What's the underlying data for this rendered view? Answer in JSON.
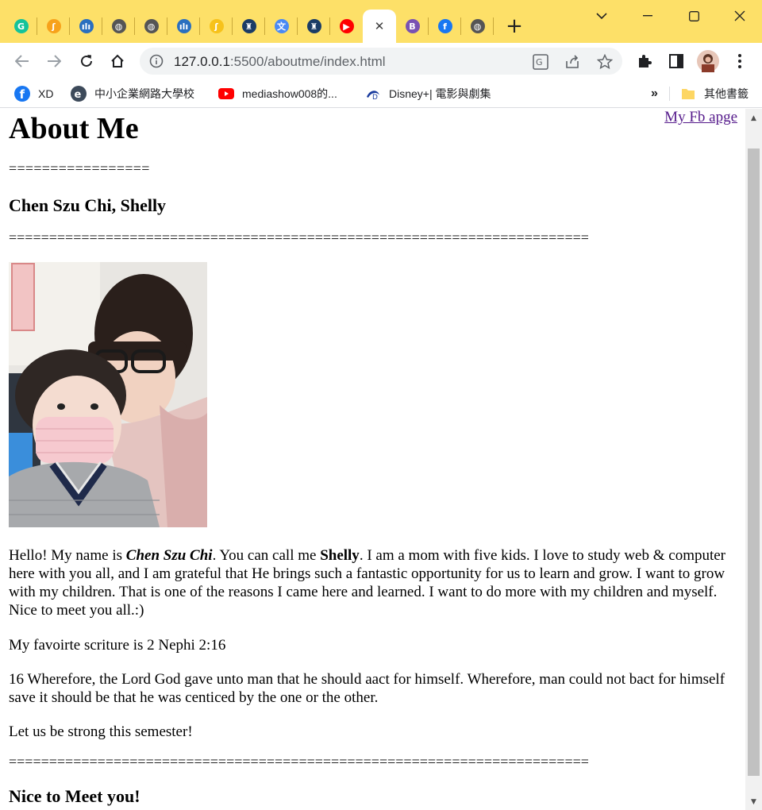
{
  "browser": {
    "tabs": [
      {
        "icon": "grammarly-icon",
        "color": "#15c39a",
        "glyph": "G"
      },
      {
        "icon": "orange-logo-icon",
        "color": "#f7a21b",
        "glyph": "ʃ"
      },
      {
        "icon": "audio-bars-icon",
        "color": "#2a6fbf",
        "glyph": "ılı"
      },
      {
        "icon": "globe-icon",
        "color": "#555555",
        "glyph": "◍"
      },
      {
        "icon": "globe-icon",
        "color": "#555555",
        "glyph": "◍"
      },
      {
        "icon": "audio-bars-icon",
        "color": "#2a6fbf",
        "glyph": "ılı"
      },
      {
        "icon": "orange-logo-icon",
        "color": "#f7c21b",
        "glyph": "ʃ"
      },
      {
        "icon": "byu-icon",
        "color": "#1b3c66",
        "glyph": "♜"
      },
      {
        "icon": "google-translate-icon",
        "color": "#4a8af4",
        "glyph": "文"
      },
      {
        "icon": "byu-icon",
        "color": "#1b3c66",
        "glyph": "♜"
      },
      {
        "icon": "youtube-icon",
        "color": "#ff0000",
        "glyph": "▶"
      },
      {
        "icon": "close-icon",
        "color": "#3c3c3c",
        "glyph": "✕",
        "active": true
      },
      {
        "icon": "bootstrap-icon",
        "color": "#7952b3",
        "glyph": "B"
      },
      {
        "icon": "facebook-icon",
        "color": "#1877f2",
        "glyph": "f"
      },
      {
        "icon": "globe-icon",
        "color": "#555555",
        "glyph": "◍"
      }
    ],
    "new_tab_label": "+",
    "address": {
      "host": "127.0.0.1",
      "rest": ":5500/aboutme/index.html"
    },
    "bookmarks": [
      {
        "label": "XD",
        "icon": "facebook-icon",
        "color": "#1877f2"
      },
      {
        "label": "中小企業網路大學校",
        "icon": "e-logo-icon",
        "color": "#3d4a5a"
      },
      {
        "label": "mediashow008的...",
        "icon": "youtube-icon",
        "color": "#ff0000"
      },
      {
        "label": "Disney+| 電影與劇集",
        "icon": "disney-plus-icon",
        "color": "#1a3c9e"
      }
    ],
    "bookmarks_overflow": "»",
    "other_bookmarks": "其他書籤"
  },
  "page": {
    "fb_link": "My Fb apge",
    "title": "About Me",
    "rule_short": "=================",
    "name": "Chen Szu Chi, Shelly",
    "rule_long": "========================================================================",
    "intro": {
      "p1": "Hello! My name is ",
      "name_em": "Chen Szu Chi",
      "p2": ". You can call me ",
      "nick_strong": "Shelly",
      "p3": ". I am a mom with five kids. I love to study web & computer here with you all, and I am grateful that He brings such a fantastic opportunity for us to learn and grow. I want to grow with my children. That is one of the reasons I came here and learned. I want to do more with my children and myself. Nice to meet you all.:)"
    },
    "scripture_intro": "My favoirte scriture is 2 Nephi 2:16",
    "scripture_text": "16 Wherefore, the Lord God gave unto man that he should aact for himself. Wherefore, man could not bact for himself save it should be that he was centiced by the one or the other.",
    "closing": "Let us be strong this semester!",
    "footer_heading": "Nice to Meet you!"
  }
}
